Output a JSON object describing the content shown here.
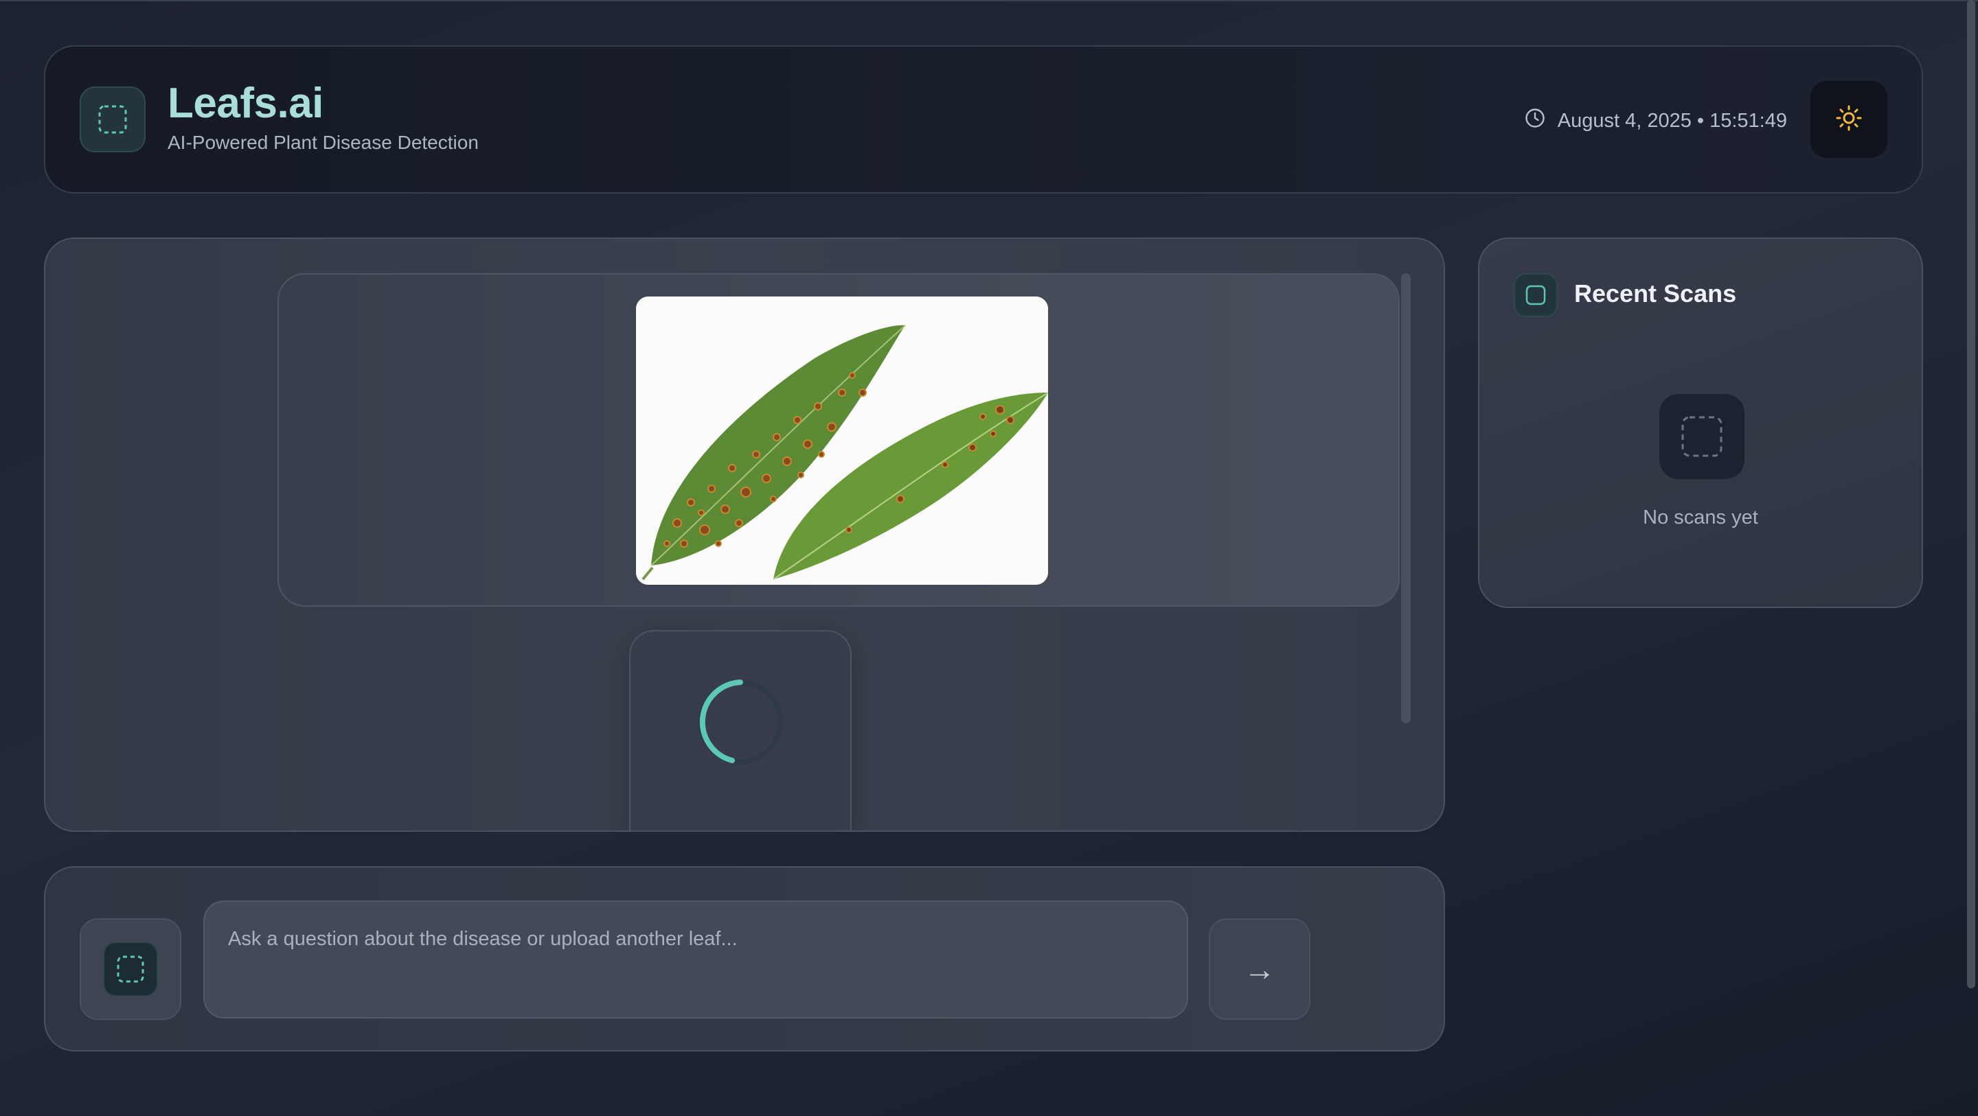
{
  "header": {
    "app_title": "Leafs.ai",
    "subtitle": "AI-Powered Plant Disease Detection",
    "datetime": "August 4, 2025 • 15:51:49",
    "logo_icon": "leaf-logo-icon",
    "theme_icon": "sun-icon"
  },
  "chat": {
    "uploaded_image_alt": "Two mango leaves with brown spots",
    "loading": true
  },
  "recent_scans": {
    "title": "Recent Scans",
    "empty_text": "No scans yet"
  },
  "composer": {
    "placeholder": "Ask a question about the disease or upload another leaf...",
    "value": "",
    "send_label": "→"
  },
  "colors": {
    "accent": "#5ec8b8",
    "brand_title": "#a9ded6",
    "sun": "#f5b942",
    "background": "#1d2230"
  }
}
